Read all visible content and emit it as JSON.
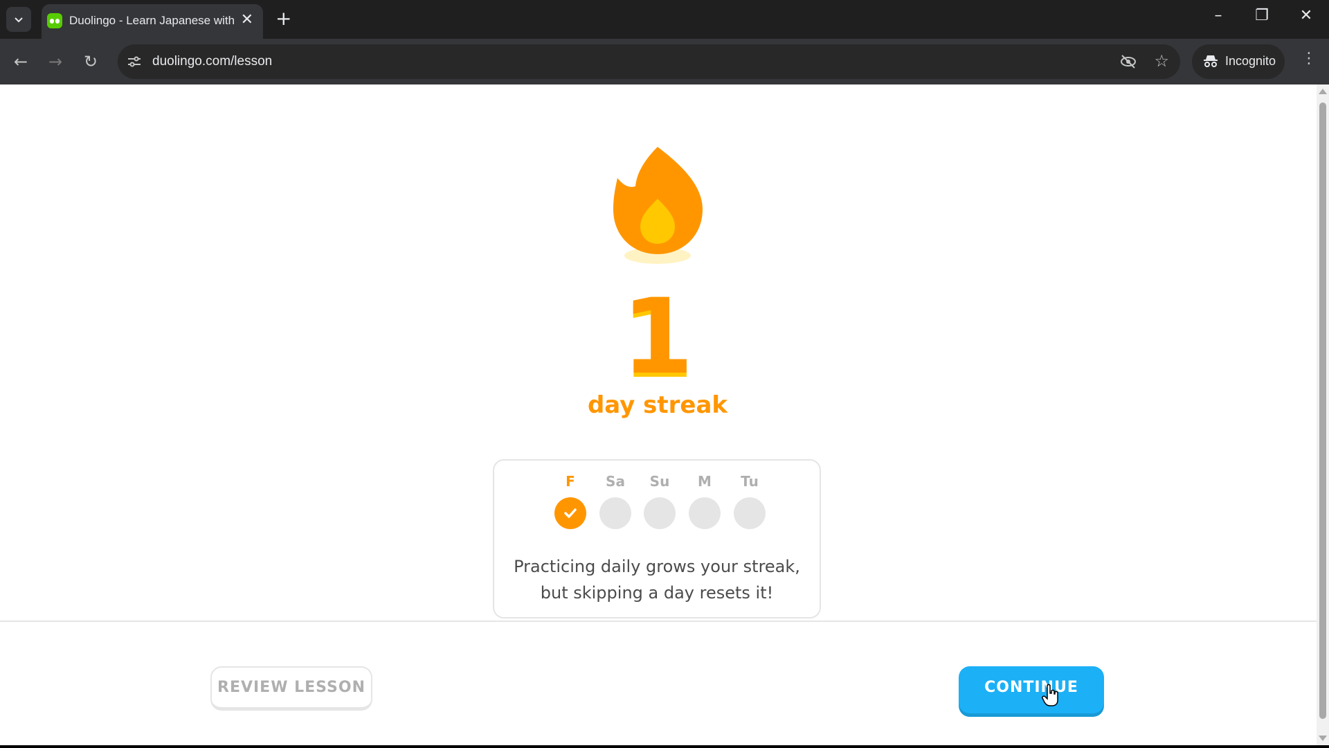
{
  "browser": {
    "tab_title": "Duolingo - Learn Japanese with",
    "url": "duolingo.com/lesson",
    "incognito_label": "Incognito",
    "icons": [
      "tab-search-icon",
      "favicon-icon",
      "close-icon",
      "plus-icon",
      "minimize-icon",
      "restore-icon",
      "close-window-icon",
      "back-icon",
      "forward-icon",
      "reload-icon",
      "site-info-icon",
      "eye-off-icon",
      "star-icon",
      "incognito-icon",
      "more-icon"
    ]
  },
  "streak": {
    "count": "1",
    "label": "day streak",
    "days": [
      {
        "label": "F",
        "done": true
      },
      {
        "label": "Sa",
        "done": false
      },
      {
        "label": "Su",
        "done": false
      },
      {
        "label": "M",
        "done": false
      },
      {
        "label": "Tu",
        "done": false
      }
    ],
    "message_line1": "Practicing daily grows your streak,",
    "message_line2": "but skipping a day resets it!"
  },
  "actions": {
    "review_label": "REVIEW LESSON",
    "continue_label": "CONTINUE"
  },
  "colors": {
    "accent_orange": "#ff9600",
    "accent_blue": "#1cb0f6",
    "inactive_gray": "#e5e5e5",
    "brand_green": "#58cc02"
  }
}
